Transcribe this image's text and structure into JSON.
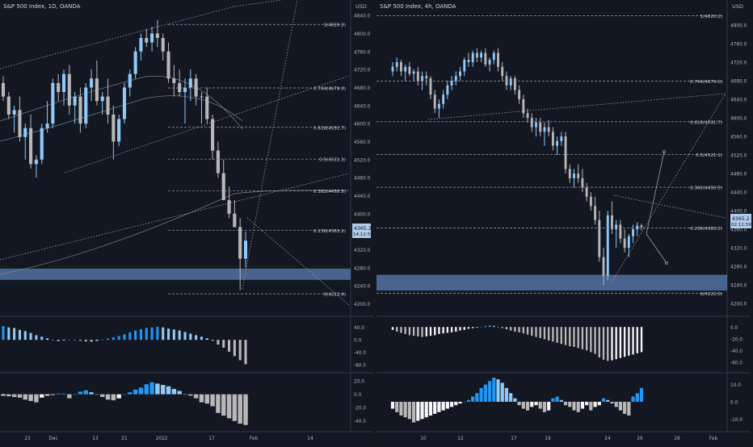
{
  "colors": {
    "bg": "#131722",
    "grid": "#2a2e39",
    "text": "#b2b5be",
    "up": "#90caf9",
    "down": "#b8b8b8",
    "zone": "#5b7db1",
    "macd_hist_up": "#64b5f6",
    "macd_hist_dn": "#e0e0e0",
    "price_tag": "#2962ff"
  },
  "left_panel": {
    "title": "S&P 500 Index, 1D, OANDA",
    "price_axis_label": "USD",
    "current_price": "4365.2",
    "current_timer": "14:12:59",
    "price_ticks": [
      "4840.0",
      "4800.0",
      "4760.0",
      "4720.0",
      "4680.0",
      "4640.0",
      "4600.0",
      "4560.0",
      "4520.0",
      "4480.0",
      "4440.0",
      "4400.0",
      "4360.0",
      "4320.0",
      "4280.0",
      "4240.0",
      "4200.0"
    ],
    "fib_labels": [
      "1(4820.2)",
      "0.764(4679.0)",
      "0.618(4591.7)",
      "0.5(4521.1)",
      "0.382(4450.5)",
      "0.236(4363.2)",
      "0(4222.0)"
    ],
    "osc1_ticks": [
      "40.0",
      "0.0",
      "-40.0",
      "-80.0"
    ],
    "osc2_ticks": [
      "20.0",
      "0.0",
      "-20.0",
      "-40.0"
    ],
    "time_labels": [
      "23",
      "Dec",
      "13",
      "21",
      "2022",
      "17",
      "Feb",
      "14"
    ]
  },
  "right_panel": {
    "title": "S&P 500 Index, 4h, OANDA",
    "price_axis_label": "USD",
    "current_price": "4365.2",
    "current_timer": "02:12:59",
    "price_ticks": [
      "4800.0",
      "4760.0",
      "4720.0",
      "4680.0",
      "4640.0",
      "4600.0",
      "4560.0",
      "4520.0",
      "4480.0",
      "4440.0",
      "4400.0",
      "4360.0",
      "4320.0",
      "4280.0",
      "4240.0",
      "4200.0"
    ],
    "fib_labels": [
      "1(4820.2)",
      "0.764(4679.0)",
      "0.618(4591.7)",
      "0.5(4521.1)",
      "0.382(4450.5)",
      "0.236(4363.2)",
      "0(4222.0)"
    ],
    "osc1_ticks": [
      "0.0",
      "-20.0",
      "-40.0",
      "-60.0"
    ],
    "osc2_ticks": [
      "10.0",
      "0.0",
      "-10.0"
    ],
    "time_labels": [
      "10",
      "12",
      "17",
      "19",
      "24",
      "26",
      "28",
      "Feb"
    ]
  },
  "chart_data": [
    {
      "type": "candlestick",
      "title": "S&P 500 Index, 1D, OANDA",
      "ylim": [
        4190,
        4860
      ],
      "fib_levels": [
        4820.2,
        4679.0,
        4591.7,
        4521.1,
        4450.5,
        4363.2,
        4222.0
      ],
      "support_zone": [
        4253,
        4278
      ],
      "candles": [
        [
          4690,
          4705,
          4650,
          4660
        ],
        [
          4660,
          4670,
          4610,
          4620
        ],
        [
          4620,
          4640,
          4580,
          4630
        ],
        [
          4630,
          4660,
          4560,
          4570
        ],
        [
          4570,
          4600,
          4520,
          4590
        ],
        [
          4590,
          4620,
          4500,
          4510
        ],
        [
          4510,
          4530,
          4480,
          4520
        ],
        [
          4520,
          4600,
          4510,
          4590
        ],
        [
          4590,
          4650,
          4580,
          4600
        ],
        [
          4600,
          4700,
          4590,
          4690
        ],
        [
          4690,
          4710,
          4650,
          4670
        ],
        [
          4670,
          4720,
          4640,
          4710
        ],
        [
          4710,
          4730,
          4620,
          4640
        ],
        [
          4640,
          4670,
          4600,
          4660
        ],
        [
          4660,
          4680,
          4580,
          4600
        ],
        [
          4600,
          4690,
          4590,
          4680
        ],
        [
          4680,
          4720,
          4650,
          4700
        ],
        [
          4700,
          4740,
          4640,
          4650
        ],
        [
          4650,
          4670,
          4620,
          4660
        ],
        [
          4660,
          4700,
          4600,
          4620
        ],
        [
          4620,
          4640,
          4520,
          4560
        ],
        [
          4560,
          4620,
          4550,
          4610
        ],
        [
          4610,
          4690,
          4600,
          4680
        ],
        [
          4680,
          4720,
          4660,
          4710
        ],
        [
          4710,
          4770,
          4700,
          4760
        ],
        [
          4760,
          4800,
          4740,
          4790
        ],
        [
          4790,
          4810,
          4770,
          4780
        ],
        [
          4780,
          4815,
          4760,
          4800
        ],
        [
          4800,
          4830,
          4770,
          4790
        ],
        [
          4790,
          4800,
          4740,
          4760
        ],
        [
          4760,
          4780,
          4690,
          4700
        ],
        [
          4700,
          4730,
          4660,
          4690
        ],
        [
          4690,
          4720,
          4660,
          4670
        ],
        [
          4670,
          4700,
          4600,
          4680
        ],
        [
          4680,
          4720,
          4650,
          4700
        ],
        [
          4700,
          4710,
          4640,
          4660
        ],
        [
          4660,
          4670,
          4600,
          4660
        ],
        [
          4660,
          4680,
          4600,
          4610
        ],
        [
          4610,
          4620,
          4520,
          4540
        ],
        [
          4540,
          4560,
          4480,
          4490
        ],
        [
          4490,
          4520,
          4430,
          4430
        ],
        [
          4430,
          4460,
          4390,
          4400
        ],
        [
          4400,
          4430,
          4370,
          4370
        ],
        [
          4370,
          4390,
          4230,
          4300
        ],
        [
          4300,
          4360,
          4280,
          4340
        ]
      ],
      "macd_hist": [
        44,
        40,
        38,
        32,
        28,
        22,
        15,
        10,
        5,
        0,
        -4,
        -2,
        0,
        -1,
        -3,
        -5,
        -6,
        -3,
        0,
        4,
        8,
        12,
        18,
        24,
        30,
        34,
        38,
        40,
        42,
        40,
        36,
        33,
        30,
        25,
        20,
        15,
        10,
        5,
        -3,
        -15,
        -25,
        -38,
        -52,
        -65,
        -78
      ],
      "osc2": [
        -2,
        -3,
        -4,
        -5,
        -8,
        -10,
        -12,
        -5,
        -2,
        -1,
        1,
        1,
        -6,
        0,
        4,
        6,
        3,
        0,
        -4,
        -8,
        -9,
        -6,
        0,
        3,
        7,
        10,
        15,
        18,
        16,
        14,
        12,
        8,
        5,
        0,
        -2,
        -6,
        -12,
        -14,
        -18,
        -28,
        -32,
        -36,
        -40,
        -44,
        -46
      ]
    },
    {
      "type": "candlestick",
      "title": "S&P 500 Index, 4h, OANDA",
      "ylim": [
        4190,
        4840
      ],
      "fib_levels": [
        4820.2,
        4679.0,
        4591.7,
        4521.1,
        4450.5,
        4363.2,
        4222.0
      ],
      "support_zone": [
        4228,
        4262
      ],
      "candles": [
        [
          4700,
          4720,
          4690,
          4710
        ],
        [
          4710,
          4730,
          4700,
          4720
        ],
        [
          4720,
          4725,
          4690,
          4700
        ],
        [
          4700,
          4715,
          4680,
          4710
        ],
        [
          4710,
          4720,
          4690,
          4695
        ],
        [
          4695,
          4705,
          4680,
          4700
        ],
        [
          4700,
          4710,
          4670,
          4680
        ],
        [
          4680,
          4700,
          4660,
          4690
        ],
        [
          4690,
          4700,
          4670,
          4685
        ],
        [
          4685,
          4690,
          4640,
          4650
        ],
        [
          4650,
          4660,
          4610,
          4620
        ],
        [
          4620,
          4640,
          4600,
          4630
        ],
        [
          4630,
          4660,
          4620,
          4650
        ],
        [
          4650,
          4680,
          4640,
          4670
        ],
        [
          4670,
          4690,
          4660,
          4680
        ],
        [
          4680,
          4700,
          4670,
          4690
        ],
        [
          4690,
          4710,
          4680,
          4700
        ],
        [
          4700,
          4730,
          4690,
          4725
        ],
        [
          4725,
          4740,
          4710,
          4720
        ],
        [
          4720,
          4745,
          4710,
          4740
        ],
        [
          4740,
          4750,
          4720,
          4730
        ],
        [
          4730,
          4745,
          4720,
          4740
        ],
        [
          4740,
          4750,
          4710,
          4715
        ],
        [
          4715,
          4730,
          4700,
          4725
        ],
        [
          4725,
          4745,
          4715,
          4740
        ],
        [
          4740,
          4750,
          4700,
          4710
        ],
        [
          4710,
          4720,
          4680,
          4690
        ],
        [
          4690,
          4700,
          4660,
          4670
        ],
        [
          4670,
          4690,
          4660,
          4685
        ],
        [
          4685,
          4690,
          4650,
          4660
        ],
        [
          4660,
          4670,
          4630,
          4640
        ],
        [
          4640,
          4650,
          4600,
          4610
        ],
        [
          4610,
          4620,
          4590,
          4600
        ],
        [
          4600,
          4610,
          4570,
          4580
        ],
        [
          4580,
          4600,
          4560,
          4590
        ],
        [
          4590,
          4600,
          4560,
          4570
        ],
        [
          4570,
          4590,
          4540,
          4580
        ],
        [
          4580,
          4595,
          4560,
          4570
        ],
        [
          4570,
          4580,
          4530,
          4540
        ],
        [
          4540,
          4560,
          4520,
          4550
        ],
        [
          4550,
          4570,
          4540,
          4560
        ],
        [
          4560,
          4570,
          4480,
          4490
        ],
        [
          4490,
          4500,
          4460,
          4470
        ],
        [
          4470,
          4490,
          4450,
          4480
        ],
        [
          4480,
          4500,
          4460,
          4470
        ],
        [
          4470,
          4490,
          4440,
          4450
        ],
        [
          4450,
          4460,
          4420,
          4430
        ],
        [
          4430,
          4440,
          4400,
          4410
        ],
        [
          4410,
          4430,
          4370,
          4380
        ],
        [
          4380,
          4400,
          4290,
          4300
        ],
        [
          4300,
          4320,
          4240,
          4260
        ],
        [
          4260,
          4400,
          4250,
          4390
        ],
        [
          4390,
          4420,
          4350,
          4360
        ],
        [
          4360,
          4380,
          4320,
          4370
        ],
        [
          4370,
          4380,
          4330,
          4340
        ],
        [
          4340,
          4360,
          4310,
          4320
        ],
        [
          4320,
          4350,
          4300,
          4345
        ],
        [
          4345,
          4370,
          4330,
          4360
        ],
        [
          4360,
          4375,
          4345,
          4368
        ],
        [
          4368,
          4372,
          4358,
          4365
        ]
      ],
      "macd_hist": [
        -5,
        -8,
        -10,
        -12,
        -14,
        -15,
        -16,
        -17,
        -16,
        -15,
        -14,
        -12,
        -11,
        -10,
        -9,
        -8,
        -6,
        -5,
        -3,
        -2,
        -1,
        0,
        2,
        3,
        2,
        0,
        -2,
        -4,
        -6,
        -8,
        -9,
        -11,
        -13,
        -15,
        -17,
        -19,
        -21,
        -23,
        -25,
        -27,
        -29,
        -31,
        -33,
        -34,
        -36,
        -38,
        -40,
        -43,
        -46,
        -52,
        -56,
        -58,
        -57,
        -55,
        -53,
        -51,
        -49,
        -47,
        -45,
        -43
      ],
      "osc2": [
        -4,
        -6,
        -8,
        -9,
        -10,
        -12,
        -11,
        -10,
        -9,
        -8,
        -7,
        -6,
        -5,
        -4,
        -3,
        -2,
        -1,
        0,
        1,
        3,
        5,
        8,
        10,
        12,
        14,
        13,
        11,
        8,
        5,
        2,
        -2,
        -4,
        -5,
        -3,
        -2,
        -4,
        -6,
        -5,
        2,
        3,
        1,
        -2,
        -3,
        -5,
        -6,
        -4,
        -2,
        -5,
        -3,
        -2,
        2,
        1,
        -1,
        -3,
        -5,
        -7,
        -8,
        3,
        5,
        8
      ]
    }
  ]
}
